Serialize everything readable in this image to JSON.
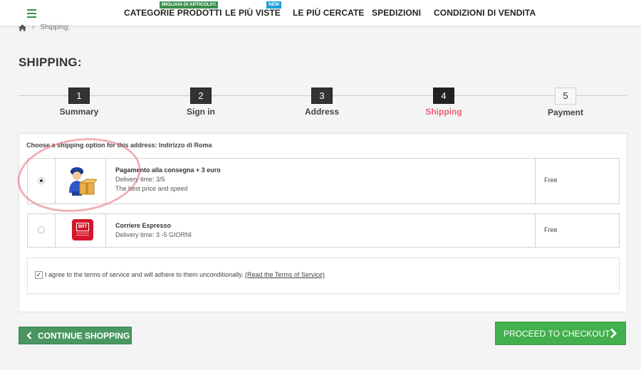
{
  "header": {
    "nav": [
      "CATEGORIE PRODOTTI",
      "LE PIÙ VISTE",
      "LE PIÙ CERCATE",
      "SPEDIZIONI",
      "CONDIZIONI DI VENDITA"
    ],
    "tag_categories": "MIGLIAIA DI ARTICOLI!!!",
    "tag_new": "NEW"
  },
  "breadcrumb": {
    "current": "Shipping:"
  },
  "page_title": "SHIPPING:",
  "steps": [
    {
      "num": "1",
      "label": "Summary"
    },
    {
      "num": "2",
      "label": "Sign in"
    },
    {
      "num": "3",
      "label": "Address"
    },
    {
      "num": "4",
      "label": "Shipping"
    },
    {
      "num": "5",
      "label": "Payment"
    }
  ],
  "shipping": {
    "choose_label": "Choose a shipping option for this address: Indirizzo di Roma",
    "options": [
      {
        "name": "Pagamento alla consegna + 3 euro",
        "delivery": "Delivery time: 3/5",
        "note": "The best price and speed",
        "price": "Free",
        "selected": true
      },
      {
        "name": "Corriere Espresso",
        "delivery": "Delivery time: 3 -5 GIORNI",
        "price": "Free",
        "logo_text": "BRT",
        "selected": false
      }
    ]
  },
  "terms": {
    "text": "I agree to the terms of service and will adhere to them unconditionally.",
    "link": "(Read the Terms of Service)"
  },
  "buttons": {
    "continue": "CONTINUE SHOPPING",
    "checkout": "PROCEED TO CHECKOUT"
  },
  "colors": {
    "brand_green": "#3a8f4b",
    "accent_pink": "#e8617a",
    "checkout_green": "#43b04e"
  }
}
